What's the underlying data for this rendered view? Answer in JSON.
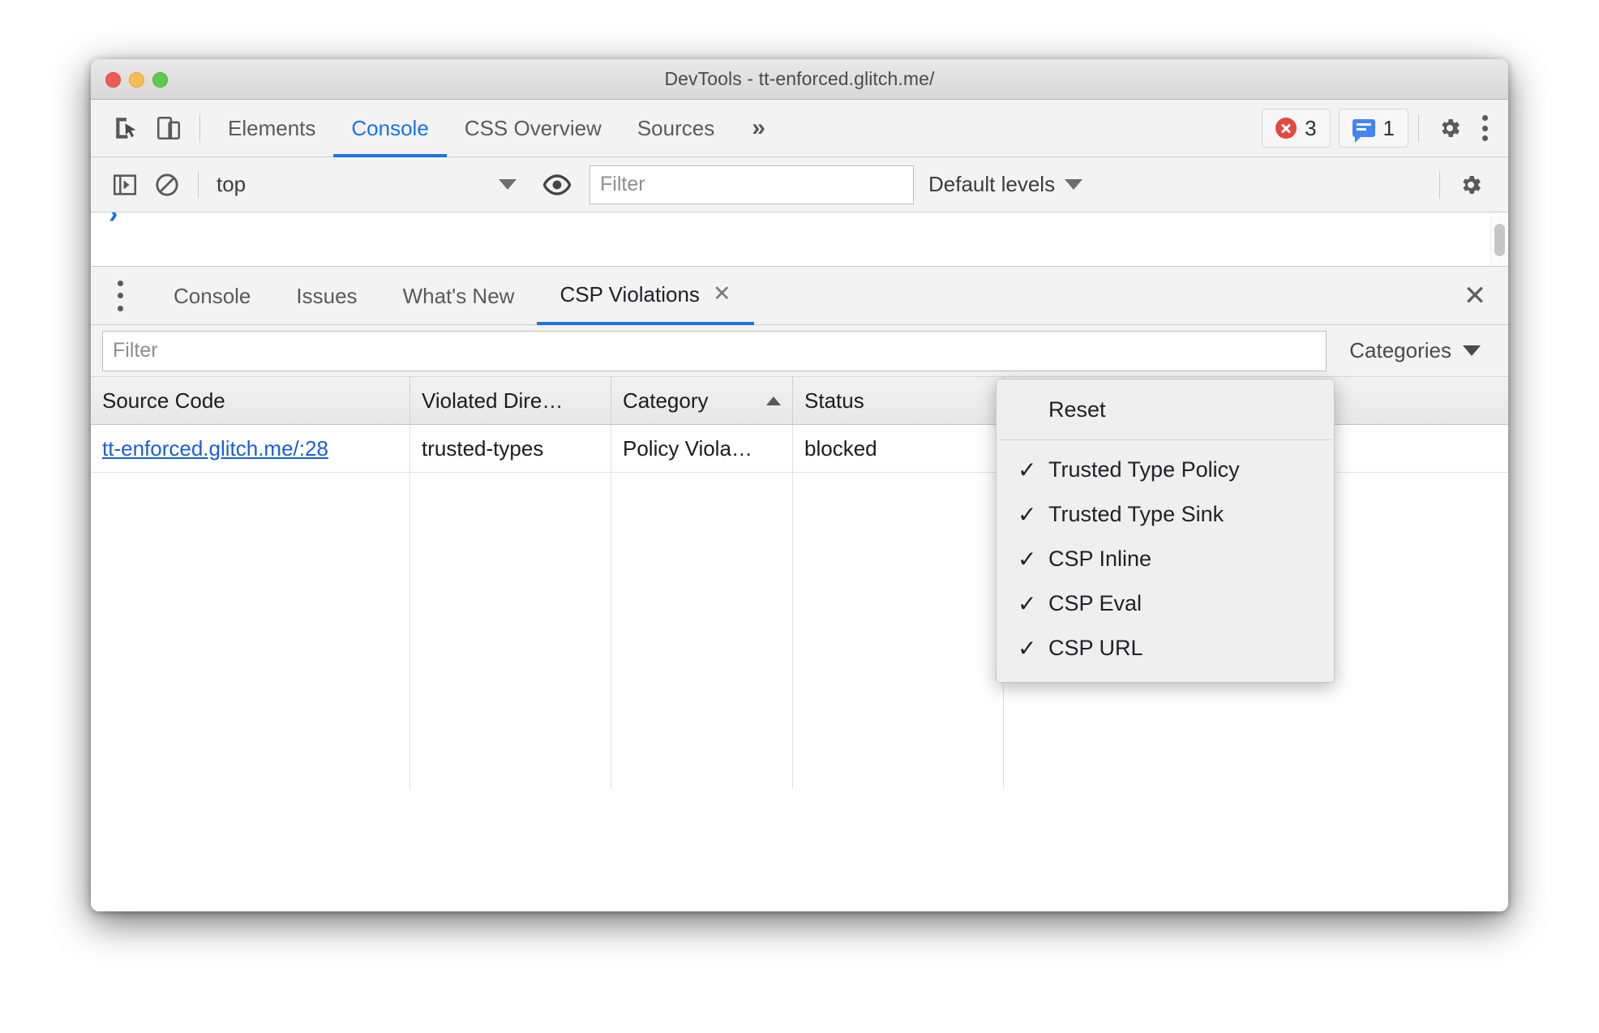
{
  "window": {
    "title": "DevTools - tt-enforced.glitch.me/",
    "traffic_lights": [
      "close",
      "minimize",
      "maximize"
    ]
  },
  "panel_toolbar": {
    "inspect_icon": "inspect-element-icon",
    "device_icon": "device-toolbar-icon",
    "tabs": [
      {
        "label": "Elements",
        "active": false
      },
      {
        "label": "Console",
        "active": true
      },
      {
        "label": "CSS Overview",
        "active": false
      },
      {
        "label": "Sources",
        "active": false
      }
    ],
    "more_tabs": "»",
    "error_badge": {
      "icon": "error-circle-icon",
      "count": "3"
    },
    "message_badge": {
      "icon": "message-bubble-icon",
      "count": "1"
    },
    "settings_icon": "gear-icon",
    "menu_icon": "kebab-menu-icon"
  },
  "console_toolbar": {
    "sidebar_toggle_icon": "console-sidebar-icon",
    "clear_icon": "clear-console-icon",
    "context": "top",
    "eye_icon": "live-expression-eye-icon",
    "filter_placeholder": "Filter",
    "filter_value": "",
    "levels_label": "Default levels",
    "settings_icon": "gear-icon"
  },
  "console_output": {
    "prompt": "›"
  },
  "drawer": {
    "menu_icon": "kebab-menu-icon",
    "tabs": [
      {
        "label": "Console",
        "active": false,
        "closable": false
      },
      {
        "label": "Issues",
        "active": false,
        "closable": false
      },
      {
        "label": "What's New",
        "active": false,
        "closable": false
      },
      {
        "label": "CSP Violations",
        "active": true,
        "closable": true,
        "close_glyph": "✕"
      }
    ],
    "close_glyph": "✕"
  },
  "csp_panel": {
    "filter_placeholder": "Filter",
    "filter_value": "",
    "categories_button": "Categories",
    "table": {
      "columns": [
        {
          "label": "Source Code",
          "sorted": false
        },
        {
          "label": "Violated Dire…",
          "sorted": false
        },
        {
          "label": "Category",
          "sorted": true,
          "sort_direction": "asc"
        },
        {
          "label": "Status",
          "sorted": false
        },
        {
          "label": "",
          "sorted": false
        }
      ],
      "rows": [
        {
          "source_code": "tt-enforced.glitch.me/:28",
          "violated_directive": "trusted-types",
          "category": "Policy Viola…",
          "status": "blocked",
          "extra": ""
        }
      ]
    }
  },
  "categories_menu": {
    "reset_label": "Reset",
    "items": [
      {
        "label": "Trusted Type Policy",
        "checked": true
      },
      {
        "label": "Trusted Type Sink",
        "checked": true
      },
      {
        "label": "CSP Inline",
        "checked": true
      },
      {
        "label": "CSP Eval",
        "checked": true
      },
      {
        "label": "CSP URL",
        "checked": true
      }
    ],
    "check_glyph": "✓"
  },
  "colors": {
    "accent_blue": "#1a73e8",
    "link_blue": "#1a5ed8",
    "error_red": "#e04a3f",
    "message_blue": "#4285f4",
    "toolbar_bg": "#f3f3f3",
    "menu_bg": "#efefef"
  }
}
